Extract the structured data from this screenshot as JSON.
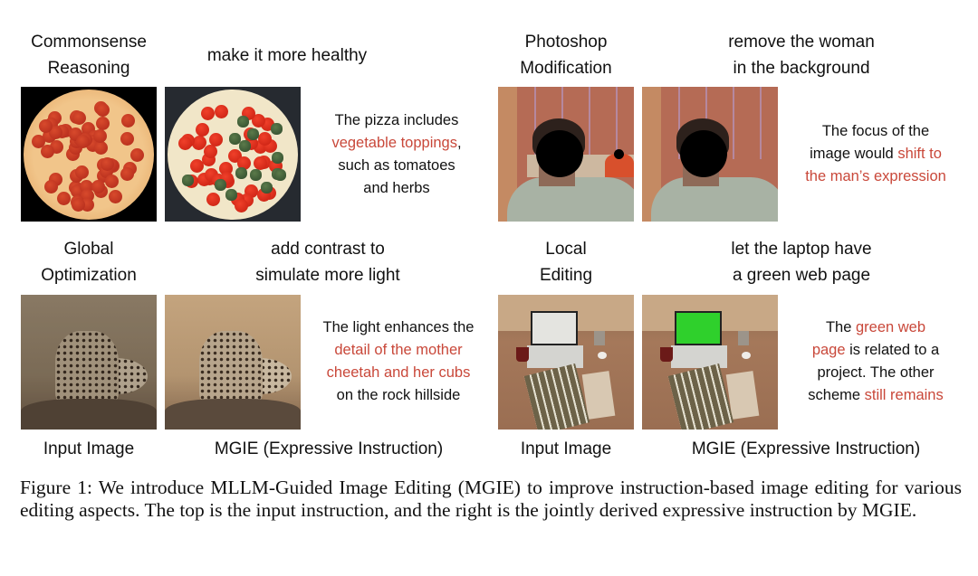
{
  "figure": {
    "panels": [
      {
        "aspect": "Commonsense Reasoning",
        "instruction": "make it more healthy",
        "input_image": "pizza-pepperoni",
        "output_image": "pizza-vegetable",
        "expressive": [
          {
            "text": "The pizza includes",
            "highlight": false
          },
          {
            "text": "vegetable toppings",
            "highlight": true
          },
          {
            "text": ",",
            "highlight": false
          },
          {
            "text": "such as tomatoes",
            "highlight": false
          },
          {
            "text": "and herbs",
            "highlight": false
          }
        ]
      },
      {
        "aspect": "Photoshop Modification",
        "instruction": "remove the woman in the background",
        "input_image": "man-with-woman-background",
        "output_image": "man-woman-removed",
        "expressive": [
          {
            "text": "The focus of the",
            "highlight": false
          },
          {
            "text": "image would",
            "highlight": false
          },
          {
            "text": "shift to",
            "highlight": true
          },
          {
            "text": "the man’s expression",
            "highlight": true
          }
        ]
      },
      {
        "aspect": "Global Optimization",
        "instruction": "add contrast to simulate more light",
        "input_image": "cheetah-dark",
        "output_image": "cheetah-bright",
        "expressive": [
          {
            "text": "The light enhances the",
            "highlight": false
          },
          {
            "text": "detail of the mother",
            "highlight": true
          },
          {
            "text": "cheetah and her cubs",
            "highlight": true
          },
          {
            "text": "on the rock hillside",
            "highlight": false
          }
        ]
      },
      {
        "aspect": "Local Editing",
        "instruction": "let the laptop have a green web page",
        "input_image": "desk-laptop",
        "output_image": "desk-laptop-green",
        "expressive": [
          {
            "text": "The",
            "highlight": false
          },
          {
            "text": "green web",
            "highlight": true
          },
          {
            "text": "page",
            "highlight": true
          },
          {
            "text": "is related to a",
            "highlight": false
          },
          {
            "text": "project. The other",
            "highlight": false
          },
          {
            "text": "scheme",
            "highlight": false
          },
          {
            "text": "still remains",
            "highlight": true
          }
        ]
      }
    ],
    "aspect_labels": {
      "p1_line1": "Commonsense",
      "p1_line2": "Reasoning",
      "p2_line1": "Photoshop",
      "p2_line2": "Modification",
      "p3_line1": "Global",
      "p3_line2": "Optimization",
      "p4_line1": "Local",
      "p4_line2": "Editing"
    },
    "instruction_labels": {
      "p1_line1": "make it more healthy",
      "p2_line1": "remove the woman",
      "p2_line2": "in the background",
      "p3_line1": "add contrast to",
      "p3_line2": "simulate more light",
      "p4_line1": "let the laptop have",
      "p4_line2": "a green web page"
    },
    "expressive_lines": {
      "p1": {
        "l1": "The pizza includes",
        "l2_hl": "vegetable toppings",
        "l2_tail": ",",
        "l3": "such as tomatoes",
        "l4": "and herbs"
      },
      "p2": {
        "l1": "The focus of the",
        "l2_pre": "image would ",
        "l2_hl": "shift to",
        "l3_hl": "the man’s expression"
      },
      "p3": {
        "l1": "The light enhances the",
        "l2_hl": "detail of the mother",
        "l3_hl": "cheetah and her cubs",
        "l4": "on the rock hillside"
      },
      "p4": {
        "l1_pre": "The ",
        "l1_hl": "green web",
        "l2_hl": "page",
        "l2_tail": " is related to a",
        "l3": "project. The other",
        "l4_pre": "scheme ",
        "l4_hl": "still remains"
      }
    },
    "column_footers": {
      "left_input": "Input Image",
      "left_output": "MGIE (Expressive Instruction)",
      "right_input": "Input Image",
      "right_output": "MGIE (Expressive Instruction)"
    },
    "caption": "Figure 1: We introduce MLLM-Guided Image Editing (MGIE) to improve instruction-based image editing for various editing aspects. The top is the input instruction, and the right is the jointly derived expressive instruction by MGIE.",
    "colors": {
      "highlight": "#c9483a",
      "text": "#111111",
      "background": "#ffffff"
    }
  }
}
